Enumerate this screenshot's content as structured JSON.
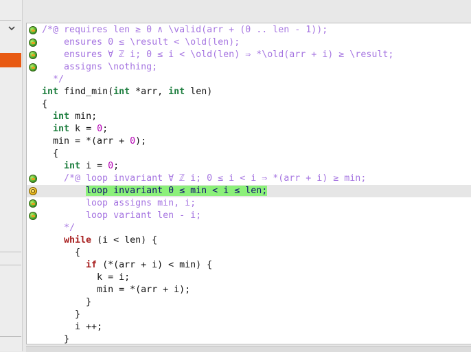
{
  "lines": [
    {
      "marker": "valid",
      "segs": [
        {
          "c": "acsl",
          "t": "/*@ requires len ≥ 0 ∧ \\valid(arr + (0 .. len - 1));"
        }
      ]
    },
    {
      "marker": "valid",
      "segs": [
        {
          "c": "acsl",
          "t": "    ensures 0 ≤ \\result < \\old(len);"
        }
      ]
    },
    {
      "marker": "valid",
      "segs": [
        {
          "c": "acsl",
          "t": "    ensures ∀ ℤ i; 0 ≤ i < \\old(len) ⇒ *\\old(arr + i) ≥ \\result;"
        }
      ]
    },
    {
      "marker": "valid",
      "segs": [
        {
          "c": "acsl",
          "t": "    assigns \\nothing;"
        }
      ]
    },
    {
      "marker": "",
      "segs": [
        {
          "c": "acsl",
          "t": "  */"
        }
      ]
    },
    {
      "marker": "",
      "segs": [
        {
          "c": "kw-type",
          "t": "int"
        },
        {
          "c": "plain",
          "t": " find_min("
        },
        {
          "c": "kw-type",
          "t": "int"
        },
        {
          "c": "plain",
          "t": " *arr, "
        },
        {
          "c": "kw-type",
          "t": "int"
        },
        {
          "c": "plain",
          "t": " len)"
        }
      ]
    },
    {
      "marker": "",
      "segs": [
        {
          "c": "plain",
          "t": "{"
        }
      ]
    },
    {
      "marker": "",
      "segs": [
        {
          "c": "plain",
          "t": "  "
        },
        {
          "c": "kw-type",
          "t": "int"
        },
        {
          "c": "plain",
          "t": " min;"
        }
      ]
    },
    {
      "marker": "",
      "segs": [
        {
          "c": "plain",
          "t": "  "
        },
        {
          "c": "kw-type",
          "t": "int"
        },
        {
          "c": "plain",
          "t": " k = "
        },
        {
          "c": "num",
          "t": "0"
        },
        {
          "c": "plain",
          "t": ";"
        }
      ]
    },
    {
      "marker": "",
      "segs": [
        {
          "c": "plain",
          "t": "  min = *(arr + "
        },
        {
          "c": "num",
          "t": "0"
        },
        {
          "c": "plain",
          "t": ");"
        }
      ]
    },
    {
      "marker": "",
      "segs": [
        {
          "c": "plain",
          "t": "  {"
        }
      ]
    },
    {
      "marker": "",
      "segs": [
        {
          "c": "plain",
          "t": "    "
        },
        {
          "c": "kw-type",
          "t": "int"
        },
        {
          "c": "plain",
          "t": " i = "
        },
        {
          "c": "num",
          "t": "0"
        },
        {
          "c": "plain",
          "t": ";"
        }
      ]
    },
    {
      "marker": "valid",
      "segs": [
        {
          "c": "acsl",
          "t": "    /*@ loop invariant ∀ ℤ i; 0 ≤ i < i ⇒ *(arr + i) ≥ min;"
        }
      ]
    },
    {
      "marker": "pending",
      "current": true,
      "segs": [
        {
          "c": "plain",
          "t": "        "
        },
        {
          "c": "hl",
          "t": "loop invariant 0 ≤ min < i ≤ len;"
        }
      ]
    },
    {
      "marker": "valid",
      "segs": [
        {
          "c": "acsl",
          "t": "        loop assigns min, i;"
        }
      ]
    },
    {
      "marker": "valid",
      "segs": [
        {
          "c": "acsl",
          "t": "        loop variant len - i;"
        }
      ]
    },
    {
      "marker": "",
      "segs": [
        {
          "c": "acsl",
          "t": "    */"
        }
      ]
    },
    {
      "marker": "",
      "segs": [
        {
          "c": "plain",
          "t": "    "
        },
        {
          "c": "kw-ctl",
          "t": "while"
        },
        {
          "c": "plain",
          "t": " (i < len) {"
        }
      ]
    },
    {
      "marker": "",
      "segs": [
        {
          "c": "plain",
          "t": "      {"
        }
      ]
    },
    {
      "marker": "",
      "segs": [
        {
          "c": "plain",
          "t": "        "
        },
        {
          "c": "kw-ctl",
          "t": "if"
        },
        {
          "c": "plain",
          "t": " (*(arr + i) < min) {"
        }
      ]
    },
    {
      "marker": "",
      "segs": [
        {
          "c": "plain",
          "t": "          k = i;"
        }
      ]
    },
    {
      "marker": "",
      "segs": [
        {
          "c": "plain",
          "t": "          min = *(arr + i);"
        }
      ]
    },
    {
      "marker": "",
      "segs": [
        {
          "c": "plain",
          "t": "        }"
        }
      ]
    },
    {
      "marker": "",
      "segs": [
        {
          "c": "plain",
          "t": "      }"
        }
      ]
    },
    {
      "marker": "",
      "segs": [
        {
          "c": "plain",
          "t": "      i ++;"
        }
      ]
    },
    {
      "marker": "",
      "segs": [
        {
          "c": "plain",
          "t": "    }"
        }
      ]
    }
  ]
}
